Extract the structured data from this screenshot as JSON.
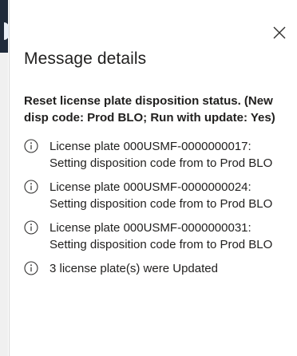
{
  "dialog": {
    "title": "Message details",
    "close_icon": "close-icon",
    "summary": "Reset license plate disposition status. (New disp code: Prod BLO; Run with update: Yes)",
    "messages": [
      {
        "icon": "info-icon",
        "text": "License plate 000USMF-0000000017: Setting disposition code from to Prod BLO"
      },
      {
        "icon": "info-icon",
        "text": "License plate 000USMF-0000000024: Setting disposition code from to Prod BLO"
      },
      {
        "icon": "info-icon",
        "text": "License plate 000USMF-0000000031: Setting disposition code from to Prod BLO"
      },
      {
        "icon": "info-icon",
        "text": "3 license plate(s) were Updated"
      }
    ]
  },
  "colors": {
    "text": "#201f1e",
    "info_icon": "#323130",
    "backdrop_nav": "#1f2a3a",
    "backdrop_accent": "#59b9e6"
  }
}
